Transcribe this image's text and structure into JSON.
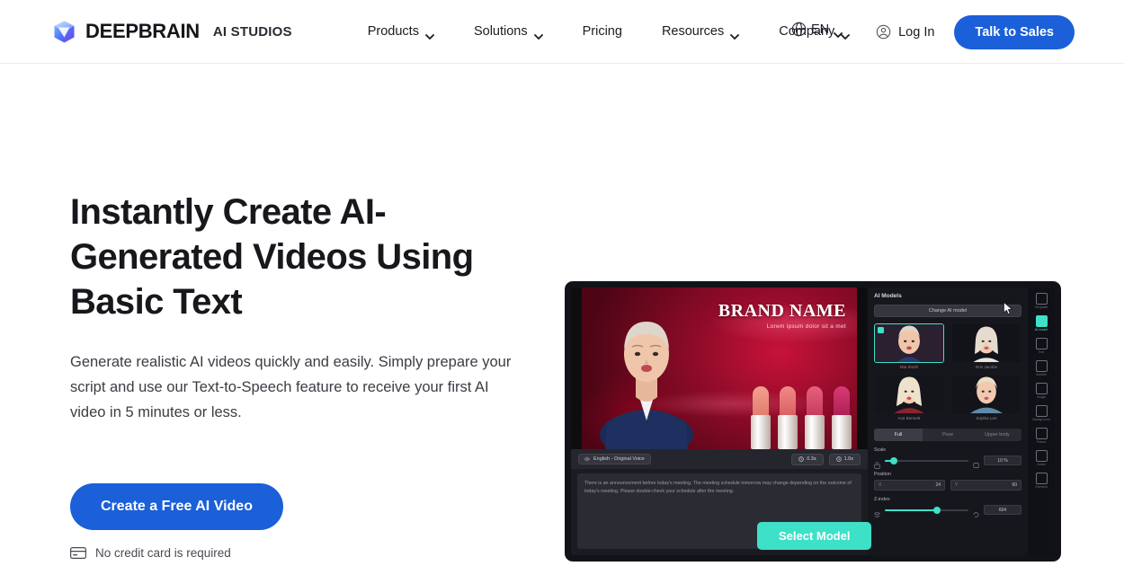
{
  "header": {
    "brand": {
      "name": "DEEPBRAIN",
      "suffix": "AI STUDIOS",
      "logo_icon": "cube-logo-icon"
    },
    "nav": [
      {
        "label": "Products",
        "has_caret": true
      },
      {
        "label": "Solutions",
        "has_caret": true
      },
      {
        "label": "Pricing",
        "has_caret": false
      },
      {
        "label": "Resources",
        "has_caret": true
      },
      {
        "label": "Company",
        "has_caret": true
      }
    ],
    "language": {
      "label": "EN",
      "icon": "globe-icon"
    },
    "login": {
      "label": "Log In",
      "icon": "user-circle-icon"
    },
    "cta": {
      "label": "Talk to Sales"
    }
  },
  "hero": {
    "title": "Instantly Create AI-Generated Videos Using Basic Text",
    "subtitle": "Generate realistic AI videos quickly and easily. Simply prepare your script and use our Text-to-Speech feature to receive your first AI video in 5 minutes or less.",
    "cta_label": "Create a Free AI Video",
    "note": "No credit card is required",
    "note_icon": "credit-card-icon"
  },
  "app_mock": {
    "video": {
      "brand_title": "BRAND NAME",
      "brand_subtitle": "Lorem ipsum dolor sit a met"
    },
    "toolbar": {
      "voice_label": "English - Original Voice",
      "voice_icon": "waveform-icon",
      "time_chips": [
        {
          "label": "0.3s",
          "icon": "clock-icon"
        },
        {
          "label": "1.0s",
          "icon": "clock-icon"
        }
      ]
    },
    "script_text": "There is an announcement before today's meeting. The meeting schedule tomorrow may change depending on the outcome of today's meeting. Please double-check your schedule after the meeting.",
    "panel": {
      "title": "AI Models",
      "change_button": "Change AI model",
      "models": [
        {
          "label": "Mia Smith",
          "selected": true
        },
        {
          "label": "Erin Jacobs",
          "selected": false
        },
        {
          "label": "Ava Bennett",
          "selected": false
        },
        {
          "label": "Sophia Lee",
          "selected": false
        }
      ],
      "segments": [
        {
          "label": "Full",
          "active": true
        },
        {
          "label": "Pose",
          "active": false
        },
        {
          "label": "Upper body",
          "active": false
        }
      ],
      "scale": {
        "label": "Scale",
        "value": "10 %",
        "percent": 10,
        "lock_icon": "lock-icon"
      },
      "position": {
        "label": "Position",
        "fields": [
          {
            "key": "X",
            "value": "24"
          },
          {
            "key": "Y",
            "value": "60"
          }
        ]
      },
      "zindex": {
        "label": "Z-index",
        "value": "604",
        "percent": 62,
        "lock_icon": "layers-icon"
      }
    },
    "rail": [
      {
        "label": "Template",
        "icon": "template-icon",
        "active": false
      },
      {
        "label": "AI model",
        "icon": "person-icon",
        "active": true
      },
      {
        "label": "Text",
        "icon": "text-icon",
        "active": false
      },
      {
        "label": "Subtitle",
        "icon": "subtitle-icon",
        "active": false
      },
      {
        "label": "Image",
        "icon": "image-icon",
        "active": false
      },
      {
        "label": "Background",
        "icon": "background-icon",
        "active": false
      },
      {
        "label": "Frame",
        "icon": "frame-icon",
        "active": false
      },
      {
        "label": "Audio",
        "icon": "audio-icon",
        "active": false
      },
      {
        "label": "Element",
        "icon": "element-icon",
        "active": false
      }
    ],
    "select_model_button": "Select Model",
    "cursor_icon": "mouse-cursor-icon"
  },
  "colors": {
    "brand_blue": "#1b5fd9",
    "accent_teal": "#3ee0c8",
    "text_dark": "#17171c",
    "app_bg": "#121318"
  }
}
